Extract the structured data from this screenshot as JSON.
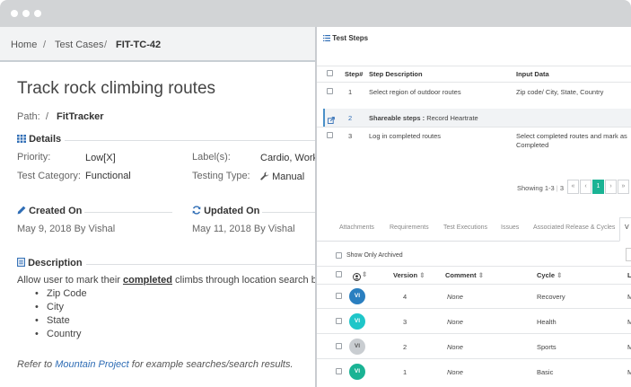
{
  "breadcrumb": {
    "home": "Home",
    "test_cases": "Test Cases",
    "current": "FIT-TC-42",
    "sep": "/"
  },
  "page": {
    "title": "Track rock climbing routes",
    "path_label": "Path:",
    "path_sep": "/",
    "path_value": "FitTracker"
  },
  "details": {
    "heading": "Details",
    "priority_label": "Priority:",
    "priority_value": "Low[X]",
    "labels_label": "Label(s):",
    "labels_value": "Cardio, Work",
    "category_label": "Test Category:",
    "category_value": "Functional",
    "testing_type_label": "Testing Type:",
    "testing_type_value": "Manual"
  },
  "created": {
    "heading": "Created On",
    "value": "May 9, 2018 By Vishal"
  },
  "updated": {
    "heading": "Updated On",
    "value": "May 11, 2018 By Vishal"
  },
  "description": {
    "heading": "Description",
    "text_before": "Allow user to mark their ",
    "text_bold": "completed",
    "text_after": " climbs through location search b",
    "bullets": [
      "Zip Code",
      "City",
      "State",
      "Country"
    ],
    "refer_before": "Refer to ",
    "refer_link": "Mountain Project",
    "refer_after": " for example searches/search results."
  },
  "test_steps": {
    "title": "Test Steps",
    "headers": {
      "step": "Step#",
      "description": "Step Description",
      "input": "Input Data"
    },
    "rows": [
      {
        "step": "1",
        "description": "Select region of outdoor routes",
        "input": "Zip code/ City, State, Country"
      },
      {
        "step": "2",
        "description_bold": "Shareable steps :",
        "description": "Record Heartrate"
      },
      {
        "step": "3",
        "description": "Log in completed routes",
        "input_line1": "Select completed routes and mark as",
        "input_line2": "Completed"
      }
    ],
    "showing": "Showing 1-3",
    "showing_sep": "|",
    "page_count": "3",
    "pager": {
      "first": "«",
      "prev": "‹",
      "current": "1",
      "next": "›",
      "last": "»"
    }
  },
  "tabs": [
    "Attachments",
    "Requirements",
    "Test Executions",
    "Issues",
    "Associated Release & Cycles",
    "V"
  ],
  "versions": {
    "archived_label": "Show Only Archived",
    "headers": {
      "version": "Version",
      "comment": "Comment",
      "cycle": "Cycle",
      "extra": "L"
    },
    "rows": [
      {
        "avatar": "VI",
        "avatar_color": "#2a7fc0",
        "version": "4",
        "comment": "None",
        "cycle": "Recovery",
        "extra": "M"
      },
      {
        "avatar": "VI",
        "avatar_color": "#1fc6c9",
        "version": "3",
        "comment": "None",
        "cycle": "Health",
        "extra": "M"
      },
      {
        "avatar": "VI",
        "avatar_color": "#c9cdd1",
        "version": "2",
        "comment": "None",
        "cycle": "Sports",
        "extra": "M"
      },
      {
        "avatar": "VI",
        "avatar_color": "#1ab394",
        "version": "1",
        "comment": "None",
        "cycle": "Basic",
        "extra": "M"
      }
    ]
  },
  "colors": {
    "accent": "#2f6db5",
    "pager_active": "#1ab394",
    "titlebar": "#d2d4d6"
  }
}
